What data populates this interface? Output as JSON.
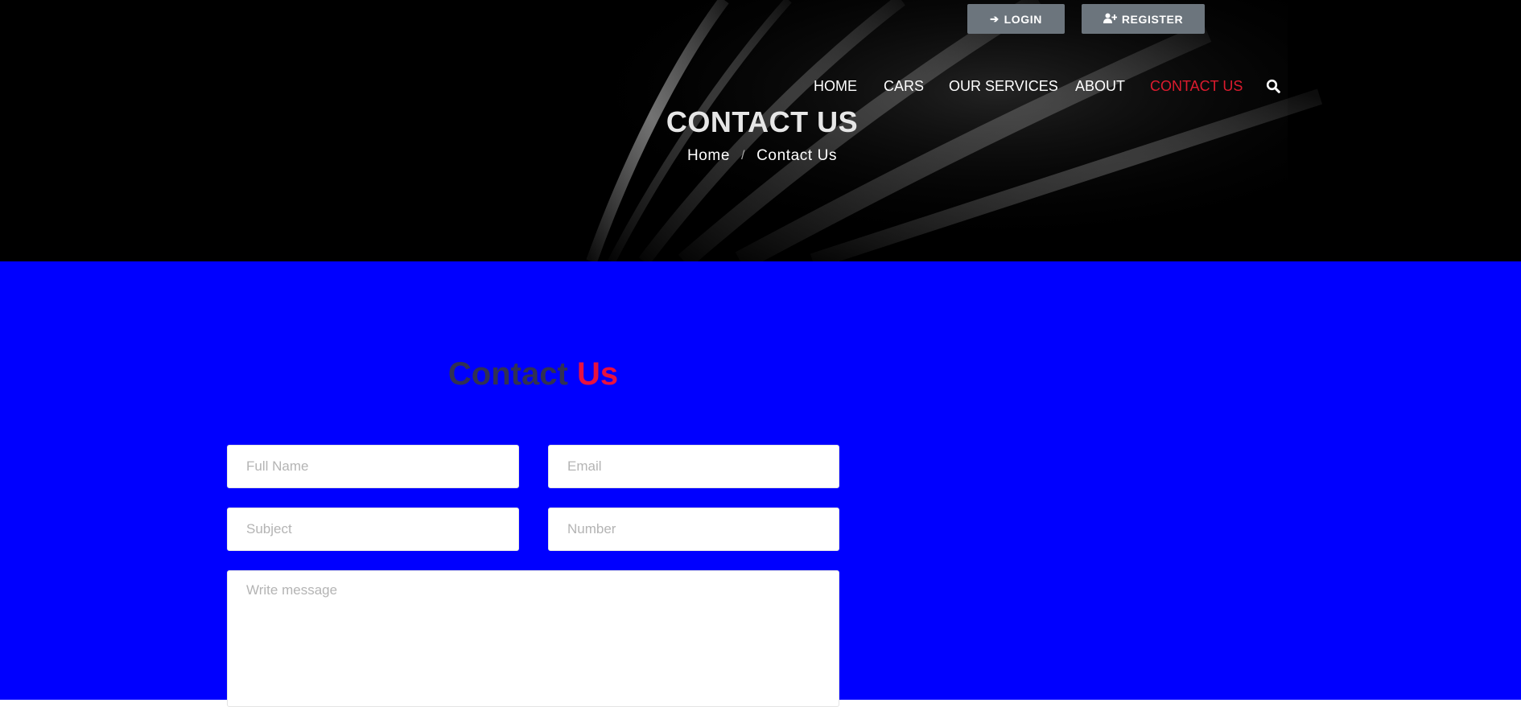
{
  "header": {
    "auth": {
      "login_label": "LOGIN",
      "register_label": "REGISTER",
      "login_icon": "sign-in-icon",
      "register_icon": "user-plus-icon"
    },
    "nav": {
      "items": [
        {
          "label": "HOME",
          "active": false
        },
        {
          "label": "CARS",
          "active": false
        },
        {
          "label": "OUR SERVICES",
          "active": false
        },
        {
          "label": "ABOUT",
          "active": false
        },
        {
          "label": "CONTACT US",
          "active": true
        }
      ],
      "search_icon": "search-icon"
    }
  },
  "hero": {
    "title": "CONTACT US",
    "breadcrumb": {
      "home": "Home",
      "separator": "/",
      "current": "Contact Us"
    }
  },
  "contact_section": {
    "heading_part1": "Contact",
    "heading_part2": "Us",
    "form": {
      "full_name_placeholder": "Full Name",
      "email_placeholder": "Email",
      "subject_placeholder": "Subject",
      "number_placeholder": "Number",
      "message_placeholder": "Write message"
    }
  },
  "colors": {
    "hero_background": "#000000",
    "section_background": "#0000ff",
    "accent_red": "#dc1b2e",
    "heading_dark": "#313152",
    "heading_red": "#e8113f",
    "button_gray": "#6c757d"
  }
}
